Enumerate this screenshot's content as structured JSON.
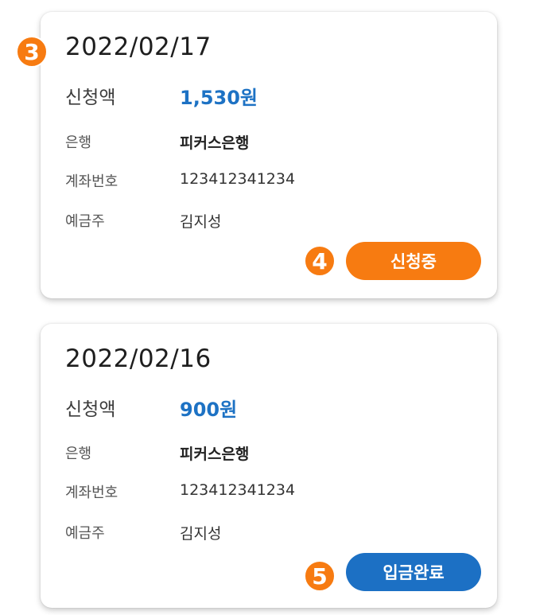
{
  "markers": [
    "3",
    "4",
    "5"
  ],
  "cards": [
    {
      "date": "2022/02/17",
      "amount_label": "신청액",
      "amount": "1,530원",
      "bank_label": "은행",
      "bank": "피커스은행",
      "account_label": "계좌번호",
      "account": "123412341234",
      "holder_label": "예금주",
      "holder": "김지성",
      "status": "신청중",
      "status_color": "#f77b11"
    },
    {
      "date": "2022/02/16",
      "amount_label": "신청액",
      "amount": "900원",
      "bank_label": "은행",
      "bank": "피커스은행",
      "account_label": "계좌번호",
      "account": "123412341234",
      "holder_label": "예금주",
      "holder": "김지성",
      "status": "입금완료",
      "status_color": "#1c70c4"
    }
  ],
  "colors": {
    "accent_orange": "#f77b11",
    "accent_blue": "#1c70c4",
    "amount_blue": "#1d72c4"
  }
}
